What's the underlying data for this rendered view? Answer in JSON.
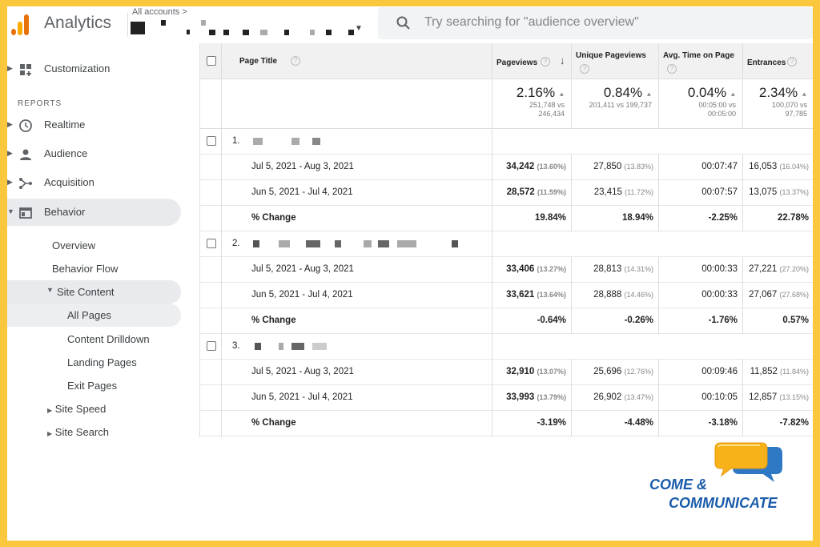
{
  "header": {
    "app_title": "Analytics",
    "account_label": "All accounts",
    "account_chevron": ">",
    "search_placeholder": "Try searching for \"audience overview\""
  },
  "sidebar": {
    "customization": "Customization",
    "reports_label": "REPORTS",
    "items": [
      {
        "label": "Realtime",
        "icon": "clock-icon"
      },
      {
        "label": "Audience",
        "icon": "person-icon"
      },
      {
        "label": "Acquisition",
        "icon": "acquisition-icon"
      },
      {
        "label": "Behavior",
        "icon": "behavior-icon"
      }
    ],
    "behavior_sub": {
      "overview": "Overview",
      "behavior_flow": "Behavior Flow",
      "site_content": "Site Content",
      "all_pages": "All Pages",
      "content_drilldown": "Content Drilldown",
      "landing_pages": "Landing Pages",
      "exit_pages": "Exit Pages",
      "site_speed": "Site Speed",
      "site_search": "Site Search"
    }
  },
  "table": {
    "columns": {
      "page_title": "Page Title",
      "pageviews": "Pageviews",
      "unique_pageviews": "Unique Pageviews",
      "avg_time": "Avg. Time on Page",
      "entrances": "Entrances"
    },
    "summary": {
      "pageviews": {
        "pct": "2.16%",
        "vs1": "251,748 vs",
        "vs2": "246,434"
      },
      "unique": {
        "pct": "0.84%",
        "vs1": "201,411 vs 199,737",
        "vs2": ""
      },
      "avg_time": {
        "pct": "0.04%",
        "vs1": "00:05:00 vs",
        "vs2": "00:05:00"
      },
      "entrances": {
        "pct": "2.34%",
        "vs1": "100,070 vs",
        "vs2": "97,785"
      }
    },
    "groups": [
      {
        "num": "1.",
        "rows": [
          {
            "label": "Jul 5, 2021 - Aug 3, 2021",
            "pv": "34,242",
            "pv_pct": "(13.60%)",
            "up": "27,850",
            "up_pct": "(13.83%)",
            "time": "00:07:47",
            "ent": "16,053",
            "ent_pct": "(16.04%)"
          },
          {
            "label": "Jun 5, 2021 - Jul 4, 2021",
            "pv": "28,572",
            "pv_pct": "(11.59%)",
            "up": "23,415",
            "up_pct": "(11.72%)",
            "time": "00:07:57",
            "ent": "13,075",
            "ent_pct": "(13.37%)"
          }
        ],
        "change": {
          "label": "% Change",
          "pv": "19.84%",
          "up": "18.94%",
          "time": "-2.25%",
          "ent": "22.78%"
        }
      },
      {
        "num": "2.",
        "rows": [
          {
            "label": "Jul 5, 2021 - Aug 3, 2021",
            "pv": "33,406",
            "pv_pct": "(13.27%)",
            "up": "28,813",
            "up_pct": "(14.31%)",
            "time": "00:00:33",
            "ent": "27,221",
            "ent_pct": "(27.20%)"
          },
          {
            "label": "Jun 5, 2021 - Jul 4, 2021",
            "pv": "33,621",
            "pv_pct": "(13.64%)",
            "up": "28,888",
            "up_pct": "(14.46%)",
            "time": "00:00:33",
            "ent": "27,067",
            "ent_pct": "(27.68%)"
          }
        ],
        "change": {
          "label": "% Change",
          "pv": "-0.64%",
          "up": "-0.26%",
          "time": "-1.76%",
          "ent": "0.57%"
        }
      },
      {
        "num": "3.",
        "rows": [
          {
            "label": "Jul 5, 2021 - Aug 3, 2021",
            "pv": "32,910",
            "pv_pct": "(13.07%)",
            "up": "25,696",
            "up_pct": "(12.76%)",
            "time": "00:09:46",
            "ent": "11,852",
            "ent_pct": "(11.84%)"
          },
          {
            "label": "Jun 5, 2021 - Jul 4, 2021",
            "pv": "33,993",
            "pv_pct": "(13.79%)",
            "up": "26,902",
            "up_pct": "(13.47%)",
            "time": "00:10:05",
            "ent": "12,857",
            "ent_pct": "(13.15%)"
          }
        ],
        "change": {
          "label": "% Change",
          "pv": "-3.19%",
          "up": "-4.48%",
          "time": "-3.18%",
          "ent": "-7.82%"
        }
      }
    ]
  },
  "brand": {
    "line1": "COME &",
    "line2": "COMMUNICATE"
  }
}
